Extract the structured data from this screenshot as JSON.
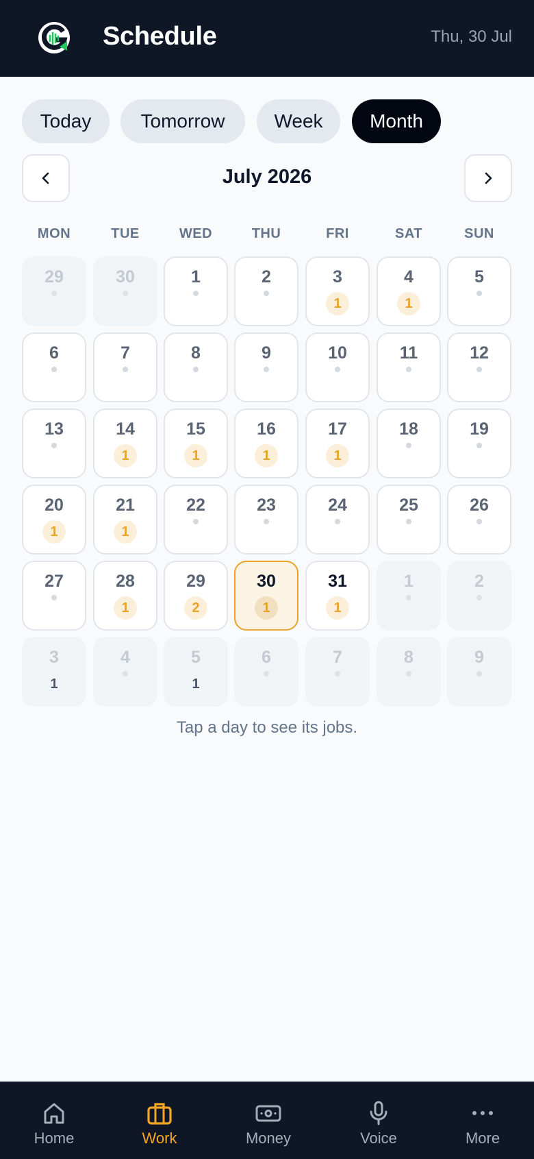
{
  "header": {
    "title": "Schedule",
    "date": "Thu, 30 Jul"
  },
  "tabs": [
    {
      "label": "Today",
      "active": false
    },
    {
      "label": "Tomorrow",
      "active": false
    },
    {
      "label": "Week",
      "active": false
    },
    {
      "label": "Month",
      "active": true
    }
  ],
  "calendar": {
    "month_title": "July 2026",
    "weekdays": [
      "MON",
      "TUE",
      "WED",
      "THU",
      "FRI",
      "SAT",
      "SUN"
    ],
    "days": [
      {
        "n": "29",
        "outside": true
      },
      {
        "n": "30",
        "outside": true
      },
      {
        "n": "1"
      },
      {
        "n": "2"
      },
      {
        "n": "3",
        "count": "1"
      },
      {
        "n": "4",
        "count": "1"
      },
      {
        "n": "5"
      },
      {
        "n": "6"
      },
      {
        "n": "7"
      },
      {
        "n": "8"
      },
      {
        "n": "9"
      },
      {
        "n": "10"
      },
      {
        "n": "11"
      },
      {
        "n": "12"
      },
      {
        "n": "13"
      },
      {
        "n": "14",
        "count": "1"
      },
      {
        "n": "15",
        "count": "1"
      },
      {
        "n": "16",
        "count": "1"
      },
      {
        "n": "17",
        "count": "1"
      },
      {
        "n": "18"
      },
      {
        "n": "19"
      },
      {
        "n": "20",
        "count": "1"
      },
      {
        "n": "21",
        "count": "1"
      },
      {
        "n": "22"
      },
      {
        "n": "23"
      },
      {
        "n": "24"
      },
      {
        "n": "25"
      },
      {
        "n": "26"
      },
      {
        "n": "27"
      },
      {
        "n": "28",
        "count": "1"
      },
      {
        "n": "29",
        "count": "2"
      },
      {
        "n": "30",
        "count": "1",
        "today": true
      },
      {
        "n": "31",
        "count": "1",
        "dark": true
      },
      {
        "n": "1",
        "outside": true
      },
      {
        "n": "2",
        "outside": true
      },
      {
        "n": "3",
        "outside": true,
        "count": "1"
      },
      {
        "n": "4",
        "outside": true
      },
      {
        "n": "5",
        "outside": true,
        "count": "1"
      },
      {
        "n": "6",
        "outside": true
      },
      {
        "n": "7",
        "outside": true
      },
      {
        "n": "8",
        "outside": true
      },
      {
        "n": "9",
        "outside": true
      }
    ],
    "hint": "Tap a day to see its jobs."
  },
  "bottom_nav": [
    {
      "label": "Home",
      "icon": "home-icon",
      "active": false
    },
    {
      "label": "Work",
      "icon": "briefcase-icon",
      "active": true
    },
    {
      "label": "Money",
      "icon": "banknote-icon",
      "active": false
    },
    {
      "label": "Voice",
      "icon": "microphone-icon",
      "active": false
    },
    {
      "label": "More",
      "icon": "more-dots-icon",
      "active": false
    }
  ],
  "colors": {
    "accent": "#f5a623",
    "header_bg": "#0f1626",
    "today_border": "#e8a32a"
  }
}
